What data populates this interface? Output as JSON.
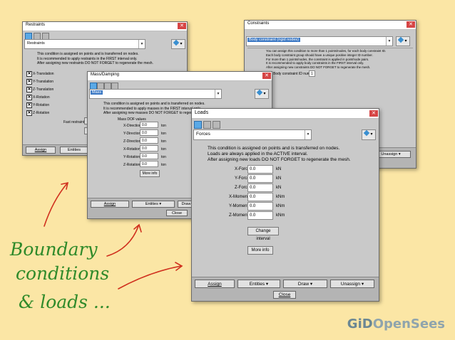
{
  "restraints": {
    "title": "Restraints",
    "combo": "Restraints",
    "desc": [
      "This condition is assigned on points and is transferred on nodes.",
      "It is recommended to apply restraints in the FIRST interval only.",
      "After assigning new restraints DO NOT FORGET to regenerate the mesh."
    ],
    "items": [
      "X-Translation",
      "Y-Translation",
      "Z-Translation",
      "X-Rotation",
      "Y-Rotation",
      "Z-Rotation"
    ],
    "fast_label": "Fast restraints",
    "assign": "Assign",
    "entities": "Entities"
  },
  "constraints": {
    "title": "Constraints",
    "combo": "Body constraint (rigid nodes)",
    "desc": [
      "You can assign this condition to more than 1 points/nodes, for each body constraint ID.",
      "Each body constraint group should have a unique positive integer ID number.",
      "For more than 1 points/nodes, the constraint is applied in point/node pairs.",
      "It is recommended to apply body constraints in the FIRST interval only.",
      "After assigning new constraints DO NOT FORGET to regenerate the mesh."
    ],
    "id_label": "Body constraint ID number",
    "id_value": "1",
    "unassign": "Unassign"
  },
  "mass": {
    "title": "Mass/Damping",
    "combo": "Mass",
    "desc": [
      "This condition is assigned on points and is transferred on nodes.",
      "It is recommended to apply masses in the FIRST interval only.",
      "After assigning new masses DO NOT FORGET to regenerate the mesh."
    ],
    "header": "Mass DOF values",
    "rows": [
      {
        "label": "X-Direction",
        "value": "0.0",
        "unit": "ton"
      },
      {
        "label": "Y-Direction",
        "value": "0.0",
        "unit": "ton"
      },
      {
        "label": "Z-Direction",
        "value": "0.0",
        "unit": "ton"
      },
      {
        "label": "X-Rotation",
        "value": "0.0",
        "unit": "ton"
      },
      {
        "label": "Y-Rotation",
        "value": "0.0",
        "unit": "ton"
      },
      {
        "label": "Z-Rotation",
        "value": "0.0",
        "unit": "ton"
      }
    ],
    "more_info": "More info",
    "assign": "Assign",
    "entities": "Entities",
    "draw": "Draw",
    "close": "Close"
  },
  "loads": {
    "title": "Loads",
    "combo": "Forces",
    "desc": [
      "This condition is assigned on points and is transferred on nodes.",
      "Loads are always applied in the ACTIVE interval.",
      "After assigning new loads DO NOT FORGET to regenerate the mesh."
    ],
    "rows": [
      {
        "label": "X-Force",
        "value": "0.0",
        "unit": "kN"
      },
      {
        "label": "Y-Force",
        "value": "0.0",
        "unit": "kN"
      },
      {
        "label": "Z-Force",
        "value": "0.0",
        "unit": "kN"
      },
      {
        "label": "X-Moment",
        "value": "0.0",
        "unit": "kNm"
      },
      {
        "label": "Y-Moment",
        "value": "0.0",
        "unit": "kNm"
      },
      {
        "label": "Z-Moment",
        "value": "0.0",
        "unit": "kNm"
      }
    ],
    "change_interval": "Change interval",
    "more_info": "More info",
    "assign": "Assign",
    "entities": "Entities",
    "draw": "Draw",
    "unassign": "Unassign",
    "close": "Close"
  },
  "annotation": [
    "Boundary",
    "conditions",
    "& loads ..."
  ],
  "logo": {
    "left": "GiD",
    "right": "OpenSees"
  },
  "colors": {
    "background": "#fbe6a5",
    "annotation": "#2f8a2a",
    "arrows": "#d0301e",
    "selected_icon": "#5aa9e6"
  }
}
